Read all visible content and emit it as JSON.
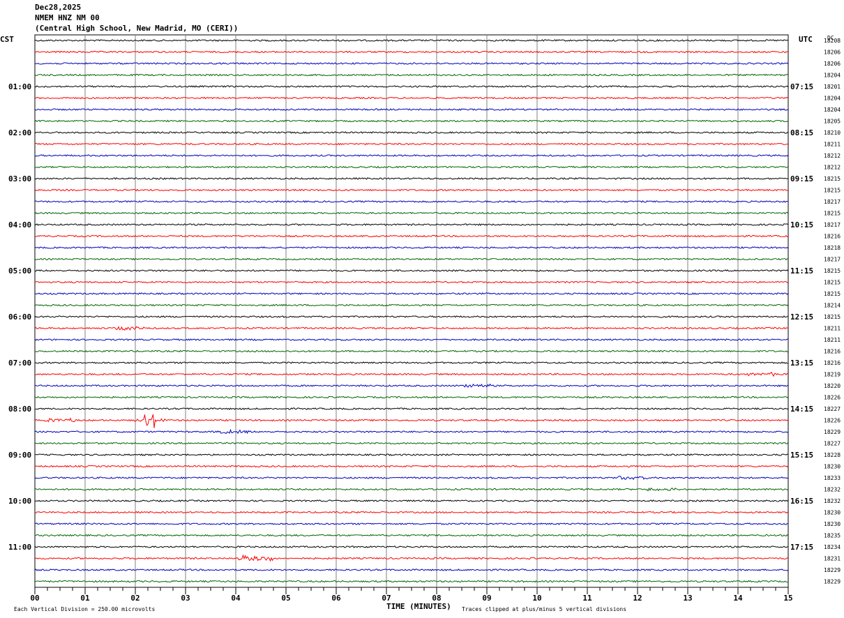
{
  "header": {
    "date": "Dec28,2025",
    "station": "NMEM HNZ NM 00",
    "location": "(Central High School, New Madrid, MO (CERI))"
  },
  "left_timezone": "CST",
  "right_timezone": "UTC",
  "dc_label": "DC",
  "footer": {
    "xlabel": "TIME (MINUTES)",
    "scale_note": "Each Vertical Division =  250.00 microvolts",
    "clip_note": "Traces clipped at plus/minus 5 vertical divisions"
  },
  "colors": {
    "trace_cycle": [
      "#000000",
      "#ff0000",
      "#0000bb",
      "#006400"
    ],
    "grid": "#808080"
  },
  "chart_data": {
    "type": "line",
    "title": "NMEM HNZ NM 00",
    "xlabel": "TIME (MINUTES)",
    "xlim": [
      0,
      15
    ],
    "x_ticks": [
      "00",
      "01",
      "02",
      "03",
      "04",
      "05",
      "06",
      "07",
      "08",
      "09",
      "10",
      "11",
      "12",
      "13",
      "14",
      "15"
    ],
    "left_hour_labels": [
      "01:00",
      "02:00",
      "03:00",
      "04:00",
      "05:00",
      "06:00",
      "07:00",
      "08:00",
      "09:00",
      "10:00",
      "11:00"
    ],
    "right_hour_labels": [
      "07:15",
      "08:15",
      "09:15",
      "10:15",
      "11:15",
      "12:15",
      "13:15",
      "14:15",
      "15:15",
      "16:15",
      "17:15"
    ],
    "traces_per_hour": 4,
    "minutes_per_trace": 15,
    "dc_offsets": [
      18208,
      18206,
      18206,
      18204,
      18201,
      18204,
      18204,
      18205,
      18210,
      18211,
      18212,
      18212,
      18215,
      18215,
      18217,
      18215,
      18217,
      18216,
      18218,
      18217,
      18215,
      18215,
      18215,
      18214,
      18215,
      18211,
      18211,
      18216,
      18216,
      18219,
      18220,
      18226,
      18227,
      18226,
      18229,
      18227,
      18228,
      18230,
      18233,
      18232,
      18232,
      18230,
      18230,
      18235,
      18234,
      18231,
      18229,
      18229
    ],
    "events": [
      {
        "trace": 25,
        "minute": 1.9,
        "amplitude": "small"
      },
      {
        "trace": 33,
        "minute": 0.5,
        "amplitude": "small"
      },
      {
        "trace": 33,
        "minute": 2.3,
        "amplitude": "large"
      },
      {
        "trace": 34,
        "minute": 4.0,
        "amplitude": "small"
      },
      {
        "trace": 38,
        "minute": 11.9,
        "amplitude": "small"
      },
      {
        "trace": 29,
        "minute": 14.5,
        "amplitude": "small"
      },
      {
        "trace": 30,
        "minute": 8.8,
        "amplitude": "small"
      },
      {
        "trace": 45,
        "minute": 4.4,
        "amplitude": "medium"
      },
      {
        "trace": 39,
        "minute": 12.5,
        "amplitude": "small"
      }
    ]
  }
}
